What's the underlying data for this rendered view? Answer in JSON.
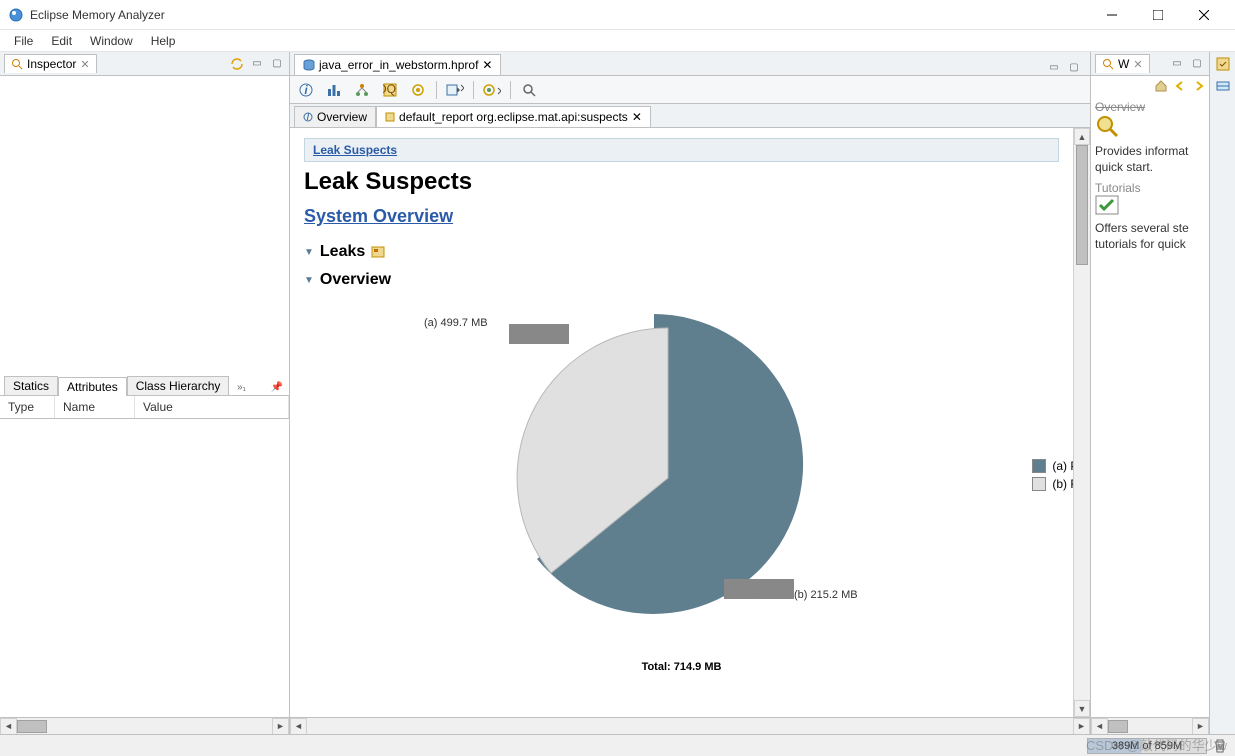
{
  "window": {
    "title": "Eclipse Memory Analyzer"
  },
  "menubar": [
    "File",
    "Edit",
    "Window",
    "Help"
  ],
  "inspector": {
    "tab_label": "Inspector",
    "lower_tabs": [
      "Statics",
      "Attributes",
      "Class Hierarchy"
    ],
    "columns": [
      "Type",
      "Name",
      "Value"
    ]
  },
  "editor": {
    "tab_label": "java_error_in_webstorm.hprof",
    "subtabs": {
      "overview": "Overview",
      "default_report": "default_report  org.eclipse.mat.api:suspects"
    }
  },
  "report": {
    "breadcrumb": "Leak Suspects",
    "h1": "Leak Suspects",
    "system_link": "System Overview",
    "section_leaks": "Leaks",
    "section_overview": "Overview",
    "callout_a": "(a)  499.7 MB",
    "callout_b": "(b)  215.2 MB",
    "total": "Total: 714.9 MB",
    "legend": {
      "a": "(a)  P",
      "b": "(b)  R"
    }
  },
  "right_panel": {
    "tab_label": "W",
    "overview_title": "Overview",
    "overview_text": "Provides informat quick start.",
    "tutorials_title": "Tutorials",
    "tutorials_text": "Offers several ste tutorials for quick"
  },
  "status": {
    "heap_text": "389M of 859M"
  },
  "watermark": "CSDN @敲代码的华少w",
  "chart_data": {
    "type": "pie",
    "title": "Leak Suspects Overview",
    "categories": [
      "(a)",
      "(b)"
    ],
    "values": [
      499.7,
      215.2
    ],
    "unit": "MB",
    "total": 714.9,
    "series_colors": [
      "#5f7f8f",
      "#e0e0e0"
    ],
    "legend_labels": [
      "(a)  P",
      "(b)  R"
    ]
  }
}
